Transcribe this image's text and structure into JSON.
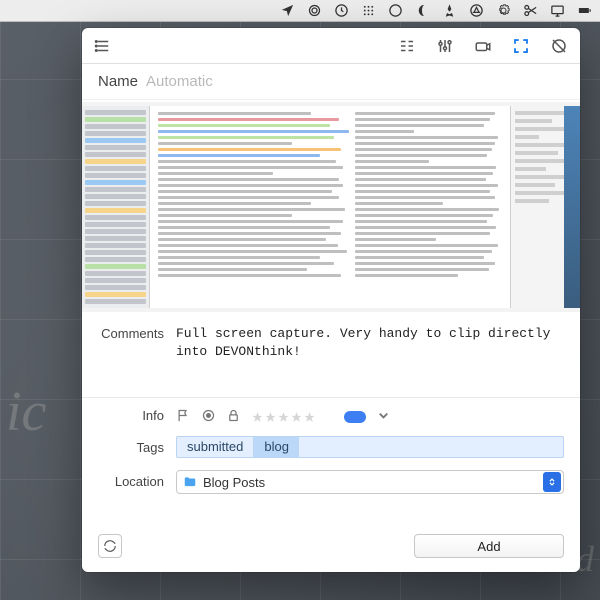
{
  "menubar_icons": [
    "location",
    "spiral",
    "clock",
    "grid",
    "activity",
    "crescent",
    "rocket",
    "appstore",
    "gear",
    "scissors",
    "display",
    "battery"
  ],
  "panel": {
    "toolbar": {
      "icons": [
        "list",
        "indent",
        "sliders",
        "camera",
        "fullscreen",
        "target"
      ],
      "active_index": 4
    },
    "name": {
      "label": "Name",
      "placeholder": "Automatic"
    },
    "comments": {
      "label": "Comments",
      "text": "Full screen capture. Very handy to clip directly into DEVONthink!"
    },
    "info": {
      "label": "Info",
      "rating": 0
    },
    "tags": {
      "label": "Tags",
      "items": [
        "submitted",
        "blog"
      ]
    },
    "location": {
      "label": "Location",
      "value": "Blog Posts"
    },
    "footer": {
      "add_label": "Add"
    }
  },
  "colors": {
    "accent": "#1f7ef0",
    "tag_bg": "#e3effe",
    "tag_bg_active": "#bcd8f8"
  }
}
